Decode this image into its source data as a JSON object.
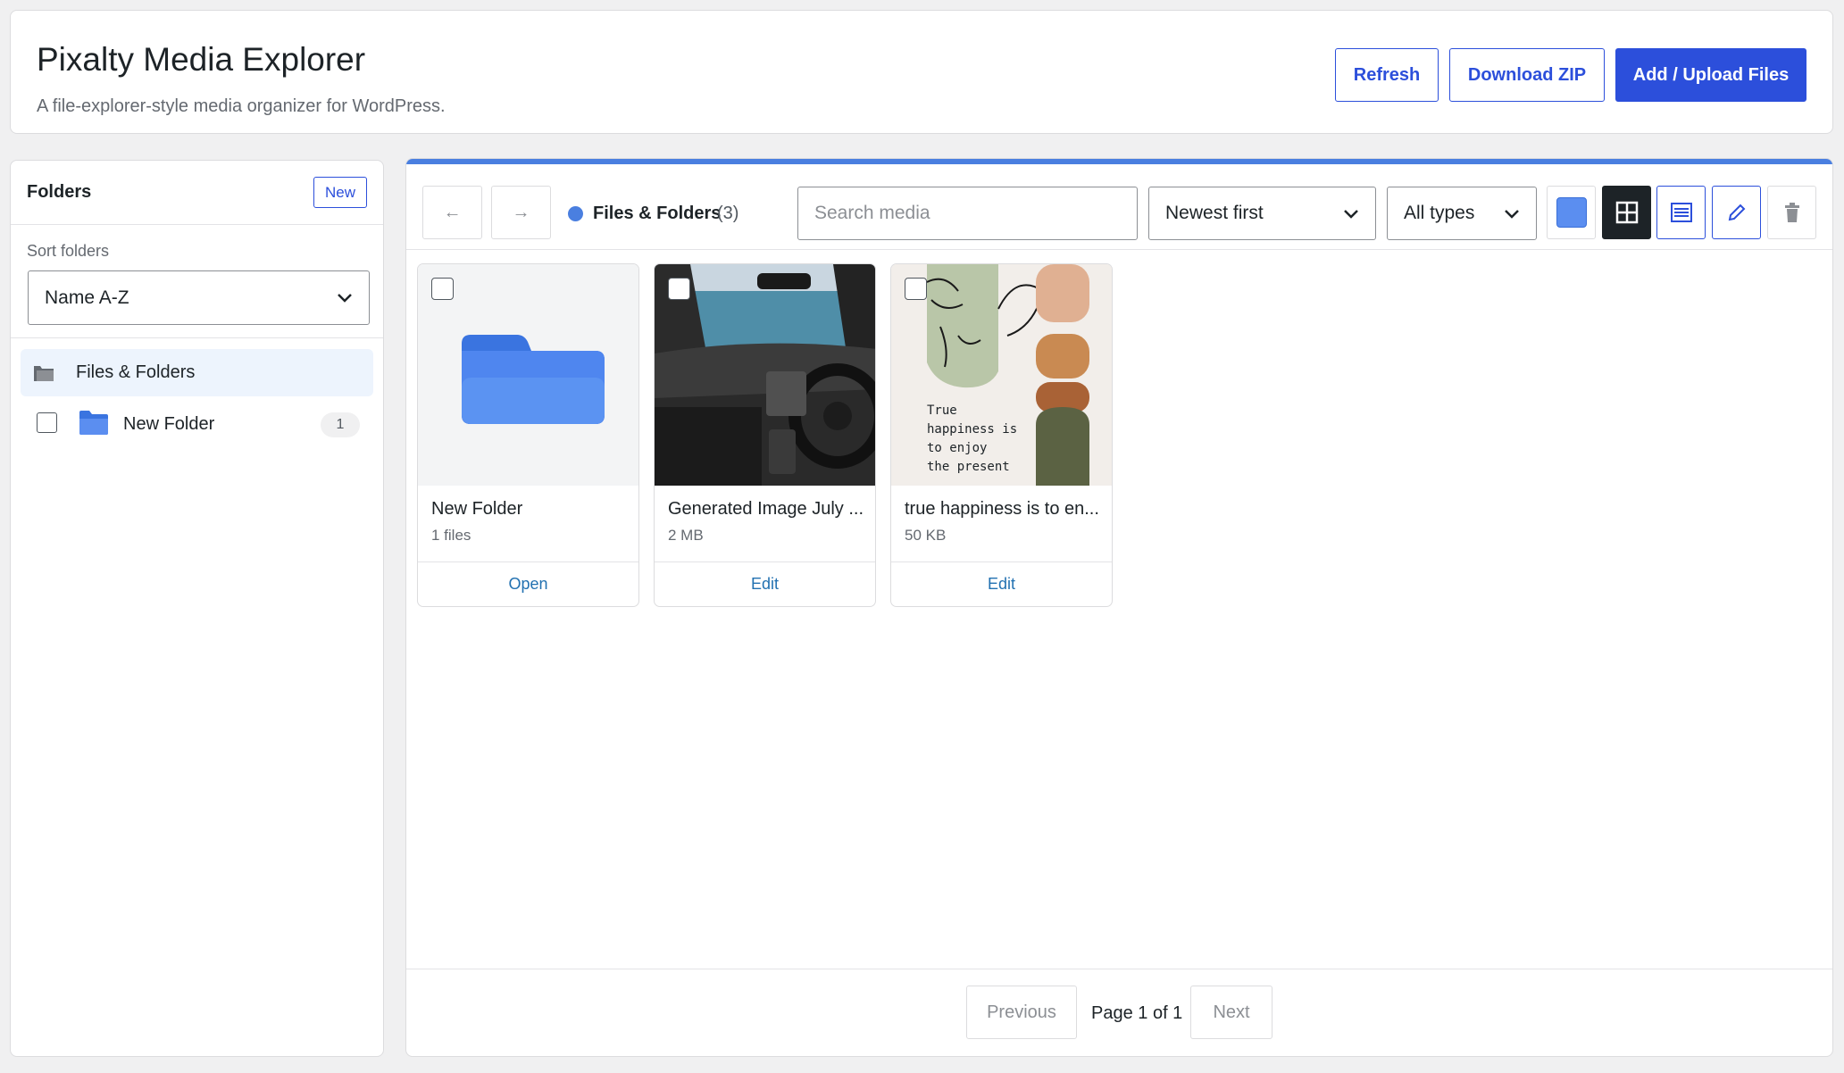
{
  "header": {
    "title": "Pixalty Media Explorer",
    "subtitle": "A file-explorer-style media organizer for WordPress.",
    "refresh_label": "Refresh",
    "download_label": "Download ZIP",
    "upload_label": "Add / Upload Files"
  },
  "sidebar": {
    "heading": "Folders",
    "new_label": "New",
    "sort_label": "Sort folders",
    "sort_value": "Name A-Z",
    "root_label": "Files & Folders",
    "folders": [
      {
        "label": "New Folder",
        "count": "1"
      }
    ]
  },
  "toolbar": {
    "back_icon": "arrow-left-icon",
    "forward_icon": "arrow-right-icon",
    "crumb_label": "Files & Folders",
    "crumb_count": "(3)",
    "search_placeholder": "Search media",
    "sort_value": "Newest first",
    "type_value": "All types"
  },
  "items": [
    {
      "name": "New Folder",
      "meta": "1 files",
      "action": "Open"
    },
    {
      "name": "Generated Image July ...",
      "meta": "2 MB",
      "action": "Edit"
    },
    {
      "name": "true happiness is to en...",
      "meta": "50 KB",
      "action": "Edit"
    }
  ],
  "poster_text": [
    "True",
    "happiness is",
    "to enjoy",
    "the present"
  ],
  "pager": {
    "prev_label": "Previous",
    "page_label": "Page 1 of 1",
    "next_label": "Next"
  },
  "colors": {
    "accent": "#4a7fe0",
    "primary_button": "#2c4fdb",
    "link": "#2271b1"
  }
}
